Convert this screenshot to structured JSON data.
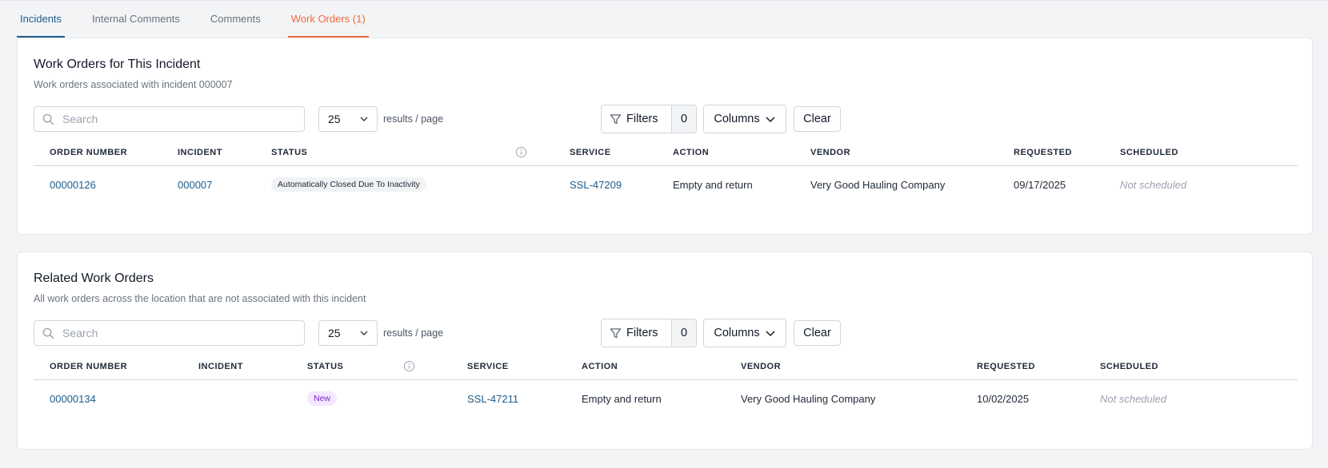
{
  "tabs": [
    {
      "label": "Incidents"
    },
    {
      "label": "Internal Comments"
    },
    {
      "label": "Comments"
    },
    {
      "label": "Work Orders (1)"
    }
  ],
  "colors": {
    "link": "#1d5c8a",
    "active_tab": "#f06a3c",
    "badge_new": "#7e22ce"
  },
  "toolbar_common": {
    "search_placeholder": "Search",
    "page_size": "25",
    "results_label": "results / page",
    "filters_label": "Filters",
    "filters_count": "0",
    "columns_label": "Columns",
    "clear_label": "Clear"
  },
  "incident_work_orders": {
    "title": "Work Orders for This Incident",
    "subtitle": "Work orders associated with incident 000007",
    "columns": [
      "ORDER NUMBER",
      "INCIDENT",
      "STATUS",
      "SERVICE",
      "ACTION",
      "VENDOR",
      "REQUESTED",
      "SCHEDULED"
    ],
    "rows": [
      {
        "order_number": "00000126",
        "incident": "000007",
        "status": "Automatically Closed Due To Inactivity",
        "service": "SSL-47209",
        "action": "Empty and return",
        "vendor": "Very Good Hauling Company",
        "requested": "09/17/2025",
        "scheduled": "Not scheduled"
      }
    ]
  },
  "related_work_orders": {
    "title": "Related Work Orders",
    "subtitle": "All work orders across the location that are not associated with this incident",
    "columns": [
      "ORDER NUMBER",
      "INCIDENT",
      "STATUS",
      "SERVICE",
      "ACTION",
      "VENDOR",
      "REQUESTED",
      "SCHEDULED"
    ],
    "rows": [
      {
        "order_number": "00000134",
        "incident": "",
        "status": "New",
        "service": "SSL-47211",
        "action": "Empty and return",
        "vendor": "Very Good Hauling Company",
        "requested": "10/02/2025",
        "scheduled": "Not scheduled"
      }
    ]
  }
}
